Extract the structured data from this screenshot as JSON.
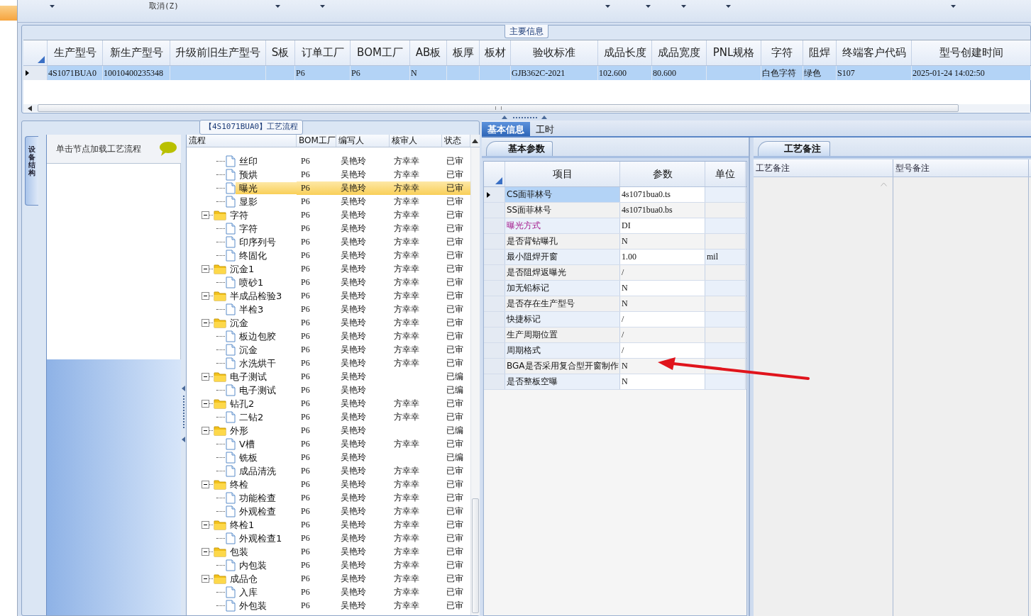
{
  "toolbar": [
    {
      "kind": "dropdown"
    },
    {
      "kind": "text",
      "label": "取消(Z)"
    },
    {
      "kind": "dropdown"
    },
    {
      "kind": "dropdown"
    },
    {
      "kind": "dropdown"
    },
    {
      "kind": "dropdown"
    },
    {
      "kind": "dropdown"
    },
    {
      "kind": "dropdown"
    },
    {
      "kind": "dropdown"
    }
  ],
  "main_info": {
    "legend": "主要信息",
    "columns": [
      "生产型号",
      "新生产型号",
      "升级前旧生产型号",
      "S板",
      "订单工厂",
      "BOM工厂",
      "AB板",
      "板厚",
      "板材",
      "验收标准",
      "成品长度",
      "成品宽度",
      "PNL规格",
      "字符",
      "阻焊",
      "终端客户代码",
      "型号创建时间"
    ],
    "rows": [
      {
        "selected": true,
        "cells": [
          "4S1071BUA0",
          "10010400235348",
          null,
          null,
          "P6",
          "P6",
          "N",
          null,
          null,
          "GJB362C-2021",
          "102.600",
          "80.600",
          null,
          "白色字符",
          "绿色",
          "S107",
          "2025-01-24 14:02:50"
        ]
      }
    ]
  },
  "process": {
    "legend": "【4S1071BUA0】工艺流程",
    "side_tab": "设备结构",
    "hint": "单击节点加载工艺流程",
    "columns": [
      "流程",
      "BOM工厂",
      "编写人",
      "核审人",
      "状态"
    ],
    "tree": [
      {
        "children": [
          {
            "kind": "file",
            "label": "丝印",
            "bom": "P6",
            "author": "吴艳玲",
            "reviewer": "方幸幸",
            "status": "已审",
            "selected": false
          },
          {
            "kind": "file",
            "label": "预烘",
            "bom": "P6",
            "author": "吴艳玲",
            "reviewer": "方幸幸",
            "status": "已审",
            "selected": false
          },
          {
            "kind": "file",
            "label": "曝光",
            "bom": "P6",
            "author": "吴艳玲",
            "reviewer": "方幸幸",
            "status": "已审",
            "selected": true
          },
          {
            "kind": "file",
            "label": "显影",
            "bom": "P6",
            "author": "吴艳玲",
            "reviewer": "方幸幸",
            "status": "已审",
            "selected": false
          }
        ]
      },
      {
        "kind": "folder",
        "label": "字符",
        "bom": "P6",
        "author": "吴艳玲",
        "reviewer": "方幸幸",
        "status": "已审",
        "selected": false,
        "expanded": true,
        "children": [
          {
            "kind": "file",
            "label": "字符",
            "bom": "P6",
            "author": "吴艳玲",
            "reviewer": "方幸幸",
            "status": "已审",
            "selected": false
          },
          {
            "kind": "file",
            "label": "印序列号",
            "bom": "P6",
            "author": "吴艳玲",
            "reviewer": "方幸幸",
            "status": "已审",
            "selected": false
          },
          {
            "kind": "file",
            "label": "终固化",
            "bom": "P6",
            "author": "吴艳玲",
            "reviewer": "方幸幸",
            "status": "已审",
            "selected": false
          }
        ]
      },
      {
        "kind": "folder",
        "label": "沉金1",
        "bom": "P6",
        "author": "吴艳玲",
        "reviewer": "方幸幸",
        "status": "已审",
        "selected": false,
        "expanded": true,
        "children": [
          {
            "kind": "file",
            "label": "喷砂1",
            "bom": "P6",
            "author": "吴艳玲",
            "reviewer": "方幸幸",
            "status": "已审",
            "selected": false
          }
        ]
      },
      {
        "kind": "folder",
        "label": "半成品检验3",
        "bom": "P6",
        "author": "吴艳玲",
        "reviewer": "方幸幸",
        "status": "已审",
        "selected": false,
        "expanded": true,
        "children": [
          {
            "kind": "file",
            "label": "半检3",
            "bom": "P6",
            "author": "吴艳玲",
            "reviewer": "方幸幸",
            "status": "已审",
            "selected": false
          }
        ]
      },
      {
        "kind": "folder",
        "label": "沉金",
        "bom": "P6",
        "author": "吴艳玲",
        "reviewer": "方幸幸",
        "status": "已审",
        "selected": false,
        "expanded": true,
        "children": [
          {
            "kind": "file",
            "label": "板边包胶",
            "bom": "P6",
            "author": "吴艳玲",
            "reviewer": "方幸幸",
            "status": "已审",
            "selected": false
          },
          {
            "kind": "file",
            "label": "沉金",
            "bom": "P6",
            "author": "吴艳玲",
            "reviewer": "方幸幸",
            "status": "已审",
            "selected": false
          },
          {
            "kind": "file",
            "label": "水洗烘干",
            "bom": "P6",
            "author": "吴艳玲",
            "reviewer": "方幸幸",
            "status": "已审",
            "selected": false
          }
        ]
      },
      {
        "kind": "folder",
        "label": "电子测试",
        "bom": "P6",
        "author": "吴艳玲",
        "status": "已编",
        "selected": false,
        "expanded": true,
        "children": [
          {
            "kind": "file",
            "label": "电子测试",
            "bom": "P6",
            "author": "吴艳玲",
            "status": "已编",
            "selected": false
          }
        ]
      },
      {
        "kind": "folder",
        "label": "钻孔2",
        "bom": "P6",
        "author": "吴艳玲",
        "reviewer": "方幸幸",
        "status": "已审",
        "selected": false,
        "expanded": true,
        "children": [
          {
            "kind": "file",
            "label": "二钻2",
            "bom": "P6",
            "author": "吴艳玲",
            "reviewer": "方幸幸",
            "status": "已审",
            "selected": false
          }
        ]
      },
      {
        "kind": "folder",
        "label": "外形",
        "bom": "P6",
        "author": "吴艳玲",
        "status": "已编",
        "selected": false,
        "expanded": true,
        "children": [
          {
            "kind": "file",
            "label": "V槽",
            "bom": "P6",
            "author": "吴艳玲",
            "reviewer": "方幸幸",
            "status": "已审",
            "selected": false
          },
          {
            "kind": "file",
            "label": "铣板",
            "bom": "P6",
            "author": "吴艳玲",
            "status": "已编",
            "selected": false
          },
          {
            "kind": "file",
            "label": "成品清洗",
            "bom": "P6",
            "author": "吴艳玲",
            "reviewer": "方幸幸",
            "status": "已审",
            "selected": false
          }
        ]
      },
      {
        "kind": "folder",
        "label": "终检",
        "bom": "P6",
        "author": "吴艳玲",
        "reviewer": "方幸幸",
        "status": "已审",
        "selected": false,
        "expanded": true,
        "children": [
          {
            "kind": "file",
            "label": "功能检查",
            "bom": "P6",
            "author": "吴艳玲",
            "reviewer": "方幸幸",
            "status": "已审",
            "selected": false
          },
          {
            "kind": "file",
            "label": "外观检查",
            "bom": "P6",
            "author": "吴艳玲",
            "reviewer": "方幸幸",
            "status": "已审",
            "selected": false
          }
        ]
      },
      {
        "kind": "folder",
        "label": "终检1",
        "bom": "P6",
        "author": "吴艳玲",
        "reviewer": "方幸幸",
        "status": "已审",
        "selected": false,
        "expanded": true,
        "children": [
          {
            "kind": "file",
            "label": "外观检查1",
            "bom": "P6",
            "author": "吴艳玲",
            "reviewer": "方幸幸",
            "status": "已审",
            "selected": false
          }
        ]
      },
      {
        "kind": "folder",
        "label": "包装",
        "bom": "P6",
        "author": "吴艳玲",
        "reviewer": "方幸幸",
        "status": "已审",
        "selected": false,
        "expanded": true,
        "children": [
          {
            "kind": "file",
            "label": "内包装",
            "bom": "P6",
            "author": "吴艳玲",
            "reviewer": "方幸幸",
            "status": "已审",
            "selected": false
          }
        ]
      },
      {
        "kind": "folder",
        "label": "成品仓",
        "bom": "P6",
        "author": "吴艳玲",
        "reviewer": "方幸幸",
        "status": "已审",
        "selected": false,
        "expanded": true,
        "children": [
          {
            "kind": "file",
            "label": "入库",
            "bom": "P6",
            "author": "吴艳玲",
            "reviewer": "方幸幸",
            "status": "已审",
            "selected": false
          },
          {
            "kind": "file",
            "label": "外包装",
            "bom": "P6",
            "author": "吴艳玲",
            "reviewer": "方幸幸",
            "status": "已审",
            "selected": false
          }
        ]
      }
    ]
  },
  "details": {
    "tabs": [
      {
        "label": "基本信息",
        "selected": true
      },
      {
        "label": "工时",
        "selected": false
      }
    ],
    "params": {
      "tab": "基本参数",
      "columns": [
        "项目",
        "参数",
        "单位"
      ],
      "rows": [
        {
          "item": "CS面菲林号",
          "value": "4s1071bua0.ts",
          "selected": true,
          "flagged": false
        },
        {
          "item": "SS面菲林号",
          "value": "4s1071bua0.bs",
          "selected": false,
          "flagged": false
        },
        {
          "item": "曝光方式",
          "value": "DI",
          "selected": false,
          "flagged": true
        },
        {
          "item": "是否背钻曝孔",
          "value": "N",
          "selected": false,
          "flagged": false
        },
        {
          "item": "最小阻焊开窗",
          "value": "1.00",
          "unit": "mil",
          "selected": false,
          "flagged": false
        },
        {
          "item": "是否阻焊返曝光",
          "value": "/",
          "selected": false,
          "flagged": false
        },
        {
          "item": "加无铅标记",
          "value": "N",
          "selected": false,
          "flagged": false
        },
        {
          "item": "是否存在生产型号",
          "value": "N",
          "selected": false,
          "flagged": false
        },
        {
          "item": "快捷标记",
          "value": "/",
          "selected": false,
          "flagged": false
        },
        {
          "item": "生产周期位置",
          "value": "/",
          "selected": false,
          "flagged": false
        },
        {
          "item": "周期格式",
          "value": "/",
          "selected": false,
          "flagged": false
        },
        {
          "item": "BGA是否采用复合型开窗制作",
          "value": "N",
          "selected": false,
          "flagged": false
        },
        {
          "item": "是否整板空曝",
          "value": "N",
          "selected": false,
          "flagged": false
        }
      ]
    },
    "notes": {
      "tab": "工艺备注",
      "columns": [
        "工艺备注",
        "型号备注"
      ]
    }
  }
}
